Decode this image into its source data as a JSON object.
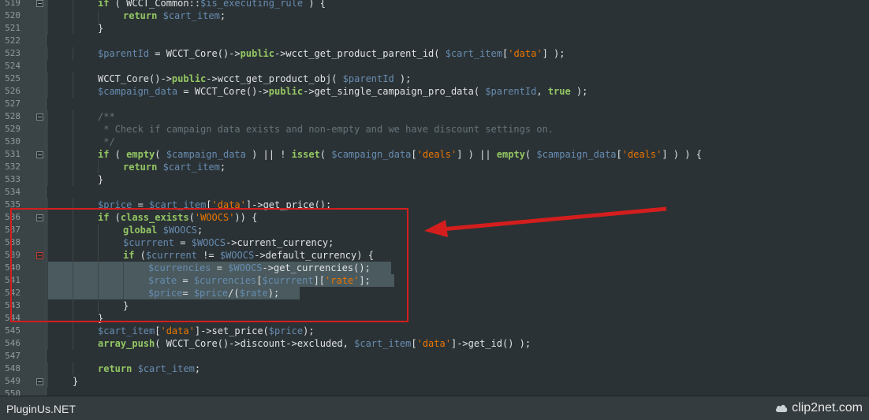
{
  "footer": {
    "site": "PluginUs.NET",
    "brand": "clip2net.com"
  },
  "lines": [
    {
      "n": "519",
      "fold": true,
      "indent": 2,
      "html": "<span class=\"kw\">if</span> ( WCCT_Common::<span class=\"var\">$is_executing_rule</span> ) {"
    },
    {
      "n": "520",
      "indent": 3,
      "html": "<span class=\"kw\">return</span> <span class=\"var\">$cart_item</span>;"
    },
    {
      "n": "521",
      "indent": 2,
      "html": "}"
    },
    {
      "n": "522",
      "indent": 0,
      "html": ""
    },
    {
      "n": "523",
      "indent": 2,
      "html": "<span class=\"var\">$parentId</span> = WCCT_Core()-><span class=\"kw\">public</span>->wcct_get_product_parent_id( <span class=\"var\">$cart_item</span>[<span class=\"str\">'data'</span>] );"
    },
    {
      "n": "524",
      "indent": 0,
      "html": ""
    },
    {
      "n": "525",
      "indent": 2,
      "html": "WCCT_Core()-><span class=\"kw\">public</span>->wcct_get_product_obj( <span class=\"var\">$parentId</span> );"
    },
    {
      "n": "526",
      "indent": 2,
      "html": "<span class=\"var\">$campaign_data</span> = WCCT_Core()-><span class=\"kw\">public</span>->get_single_campaign_pro_data( <span class=\"var\">$parentId</span>, <span class=\"kw\">true</span> );"
    },
    {
      "n": "527",
      "indent": 0,
      "html": ""
    },
    {
      "n": "528",
      "fold": true,
      "indent": 2,
      "html": "<span class=\"cm\">/**</span>"
    },
    {
      "n": "529",
      "indent": 2,
      "html": "<span class=\"cm\"> * Check if campaign data exists and non-empty and we have discount settings on.</span>"
    },
    {
      "n": "530",
      "indent": 2,
      "html": "<span class=\"cm\"> */</span>"
    },
    {
      "n": "531",
      "fold": true,
      "indent": 2,
      "html": "<span class=\"kw\">if</span> ( <span class=\"kw\">empty</span>( <span class=\"var\">$campaign_data</span> ) || ! <span class=\"kw\">isset</span>( <span class=\"var\">$campaign_data</span>[<span class=\"str\">'deals'</span>] ) || <span class=\"kw\">empty</span>( <span class=\"var\">$campaign_data</span>[<span class=\"str\">'deals'</span>] ) ) {"
    },
    {
      "n": "532",
      "indent": 3,
      "html": "<span class=\"kw\">return</span> <span class=\"var\">$cart_item</span>;"
    },
    {
      "n": "533",
      "indent": 2,
      "html": "}"
    },
    {
      "n": "534",
      "indent": 0,
      "html": ""
    },
    {
      "n": "535",
      "indent": 2,
      "html": "<span class=\"var\">$price</span> = <span class=\"var\">$cart_item</span>[<span class=\"str\">'data'</span>]->get_price();"
    },
    {
      "n": "536",
      "fold": true,
      "indent": 2,
      "html": "<span class=\"kw\">if</span> (<span class=\"kw\">class_exists</span>(<span class=\"str\">'WOOCS'</span>)) {"
    },
    {
      "n": "537",
      "indent": 3,
      "html": "<span class=\"kw\">global</span> <span class=\"var\">$WOOCS</span>;"
    },
    {
      "n": "538",
      "indent": 3,
      "html": "<span class=\"var\">$currrent</span> = <span class=\"var\">$WOOCS</span>->current_currency;"
    },
    {
      "n": "539",
      "fold": true,
      "foldRed": true,
      "indent": 3,
      "html": "<span class=\"kw\">if</span> (<span class=\"var\">$currrent</span> != <span class=\"var\">$WOOCS</span>->default_currency) {"
    },
    {
      "n": "540",
      "sel": true,
      "indent": 4,
      "html": "<span class=\"var\">$currencies</span> = <span class=\"var\">$WOOCS</span>->get_currencies();"
    },
    {
      "n": "541",
      "sel": true,
      "indent": 4,
      "html": "<span class=\"var\">$rate</span> = <span class=\"var\">$currencies</span>[<span class=\"var\">$currrent</span>][<span class=\"str\">'rate'</span>];"
    },
    {
      "n": "542",
      "sel": true,
      "indent": 4,
      "html": "<span class=\"var\">$price</span>= <span class=\"var\">$price</span>/(<span class=\"var\">$rate</span>);"
    },
    {
      "n": "543",
      "indent": 3,
      "html": "}"
    },
    {
      "n": "544",
      "indent": 2,
      "html": "}"
    },
    {
      "n": "545",
      "indent": 2,
      "html": "<span class=\"var\">$cart_item</span>[<span class=\"str\">'data'</span>]->set_price(<span class=\"var\">$price</span>);"
    },
    {
      "n": "546",
      "indent": 2,
      "html": "<span class=\"kw\">array_push</span>( WCCT_Core()->discount->excluded, <span class=\"var\">$cart_item</span>[<span class=\"str\">'data'</span>]->get_id() );"
    },
    {
      "n": "547",
      "indent": 0,
      "html": ""
    },
    {
      "n": "548",
      "indent": 2,
      "html": "<span class=\"kw\">return</span> <span class=\"var\">$cart_item</span>;"
    },
    {
      "n": "549",
      "fold": true,
      "indent": 1,
      "html": "}"
    },
    {
      "n": "550",
      "indent": 0,
      "html": ""
    }
  ]
}
